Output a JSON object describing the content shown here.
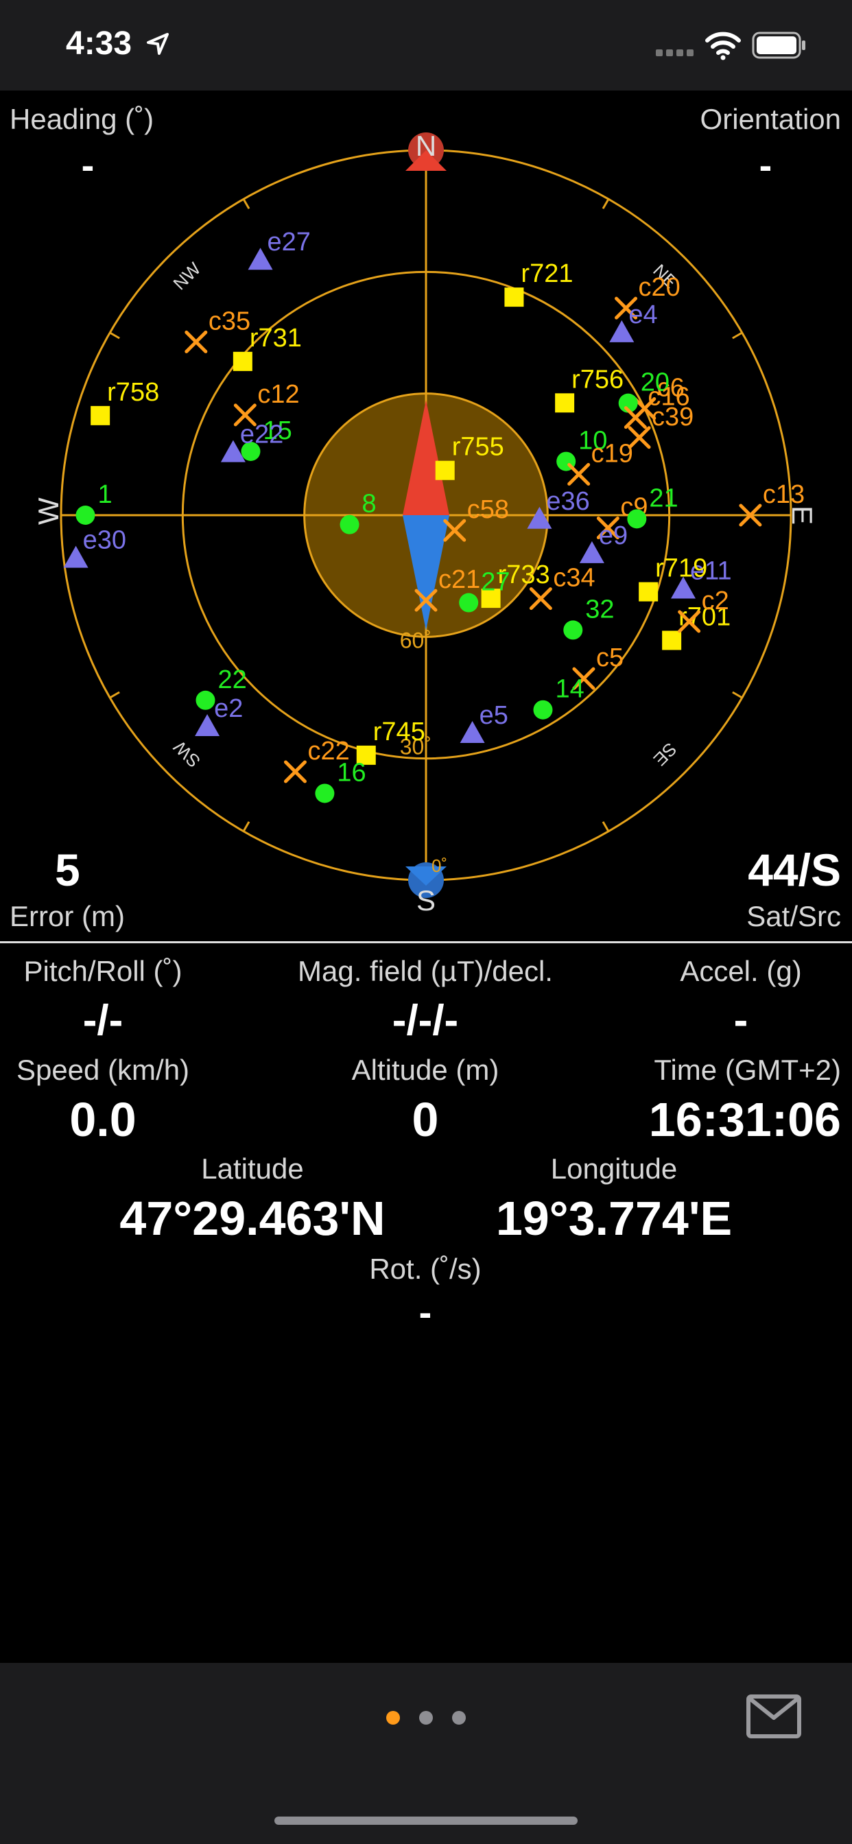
{
  "status_bar": {
    "time": "4:33"
  },
  "sky": {
    "heading_label": "Heading (˚)",
    "heading_value": "-",
    "orientation_label": "Orientation",
    "orientation_value": "-",
    "error_value": "5",
    "error_label": "Error (m)",
    "satsrc_value": "44/S",
    "satsrc_label": "Sat/Src",
    "compass": {
      "n": "N",
      "s": "S",
      "e": "E",
      "w": "W",
      "ne": "NE",
      "nw": "NW",
      "se": "SE",
      "sw": "SW"
    },
    "elevation_labels": [
      "60˚",
      "30˚",
      "0˚"
    ],
    "colors": {
      "gps": "#22ee22",
      "galileo": "#7a72e8",
      "glonass": "#ffee00",
      "beidou": "#ff9a1a",
      "ring": "#e5a21a",
      "needle_north": "#e8402f",
      "needle_south": "#2f7fe0"
    },
    "satellites": [
      {
        "label": "r721",
        "type": "glonass",
        "el": 32,
        "az": 22
      },
      {
        "label": "e27",
        "type": "galileo",
        "el": 15,
        "az": 327
      },
      {
        "label": "c35",
        "type": "beidou",
        "el": 19,
        "az": 307
      },
      {
        "label": "r731",
        "type": "glonass",
        "el": 31,
        "az": 310
      },
      {
        "label": "r758",
        "type": "glonass",
        "el": 6,
        "az": 287
      },
      {
        "label": "c12",
        "type": "beidou",
        "el": 39,
        "az": 299
      },
      {
        "label": "1",
        "type": "gps",
        "el": 6,
        "az": 270
      },
      {
        "label": "e30",
        "type": "galileo",
        "el": 3,
        "az": 263
      },
      {
        "label": "15",
        "type": "gps",
        "el": 44,
        "az": 290
      },
      {
        "label": "e22",
        "type": "galileo",
        "el": 40,
        "az": 288
      },
      {
        "label": "c20",
        "type": "beidou",
        "el": 19,
        "az": 44
      },
      {
        "label": "e4",
        "type": "galileo",
        "el": 24,
        "az": 47
      },
      {
        "label": "r756",
        "type": "glonass",
        "el": 46,
        "az": 51
      },
      {
        "label": "c6",
        "type": "beidou",
        "el": 30,
        "az": 64
      },
      {
        "label": "20",
        "type": "gps",
        "el": 33,
        "az": 61
      },
      {
        "label": "c16",
        "type": "beidou",
        "el": 33,
        "az": 65
      },
      {
        "label": "c39",
        "type": "beidou",
        "el": 34,
        "az": 70
      },
      {
        "label": "10",
        "type": "gps",
        "el": 53,
        "az": 69
      },
      {
        "label": "c19",
        "type": "beidou",
        "el": 51,
        "az": 75
      },
      {
        "label": "r755",
        "type": "glonass",
        "el": 78,
        "az": 23
      },
      {
        "label": "e36",
        "type": "galileo",
        "el": 62,
        "az": 92
      },
      {
        "label": "8",
        "type": "gps",
        "el": 71,
        "az": 263
      },
      {
        "label": "c58",
        "type": "beidou",
        "el": 82,
        "az": 118
      },
      {
        "label": "c9",
        "type": "beidou",
        "el": 45,
        "az": 94
      },
      {
        "label": "21",
        "type": "gps",
        "el": 38,
        "az": 91
      },
      {
        "label": "c13",
        "type": "beidou",
        "el": 10,
        "az": 90
      },
      {
        "label": "e9",
        "type": "galileo",
        "el": 48,
        "az": 103
      },
      {
        "label": "e11",
        "type": "galileo",
        "el": 24,
        "az": 106
      },
      {
        "label": "r719",
        "type": "glonass",
        "el": 32,
        "az": 109
      },
      {
        "label": "r701",
        "type": "glonass",
        "el": 22,
        "az": 117
      },
      {
        "label": "c2",
        "type": "beidou",
        "el": 20,
        "az": 112
      },
      {
        "label": "r733",
        "type": "glonass",
        "el": 64,
        "az": 142
      },
      {
        "label": "27",
        "type": "gps",
        "el": 66,
        "az": 154
      },
      {
        "label": "c34",
        "type": "beidou",
        "el": 55,
        "az": 126
      },
      {
        "label": "c21",
        "type": "beidou",
        "el": 69,
        "az": 180
      },
      {
        "label": "32",
        "type": "gps",
        "el": 44,
        "az": 128
      },
      {
        "label": "c5",
        "type": "beidou",
        "el": 34,
        "az": 136
      },
      {
        "label": "14",
        "type": "gps",
        "el": 34,
        "az": 149
      },
      {
        "label": "e5",
        "type": "galileo",
        "el": 35,
        "az": 168
      },
      {
        "label": "22",
        "type": "gps",
        "el": 19,
        "az": 230
      },
      {
        "label": "e2",
        "type": "galileo",
        "el": 15,
        "az": 226
      },
      {
        "label": "c22",
        "type": "beidou",
        "el": 19,
        "az": 207
      },
      {
        "label": "r745",
        "type": "glonass",
        "el": 29,
        "az": 194
      },
      {
        "label": "16",
        "type": "gps",
        "el": 17,
        "az": 200
      }
    ]
  },
  "readouts": {
    "pitch_label": "Pitch/Roll (˚)",
    "pitch_value": "-/-",
    "mag_label": "Mag. field (µT)/decl.",
    "mag_value": "-/-/-",
    "accel_label": "Accel. (g)",
    "accel_value": "-",
    "speed_label": "Speed (km/h)",
    "speed_value": "0.0",
    "altitude_label": "Altitude (m)",
    "altitude_value": "0",
    "time_label": "Time (GMT+2)",
    "time_value": "16:31:06",
    "latitude_label": "Latitude",
    "latitude_value": "47°29.463'N",
    "longitude_label": "Longitude",
    "longitude_value": "19°3.774'E",
    "rot_label": "Rot. (˚/s)",
    "rot_value": "-"
  },
  "pager": {
    "count": 3,
    "active": 0,
    "active_color": "#ff9a1a",
    "inactive_color": "#8e8e93"
  }
}
